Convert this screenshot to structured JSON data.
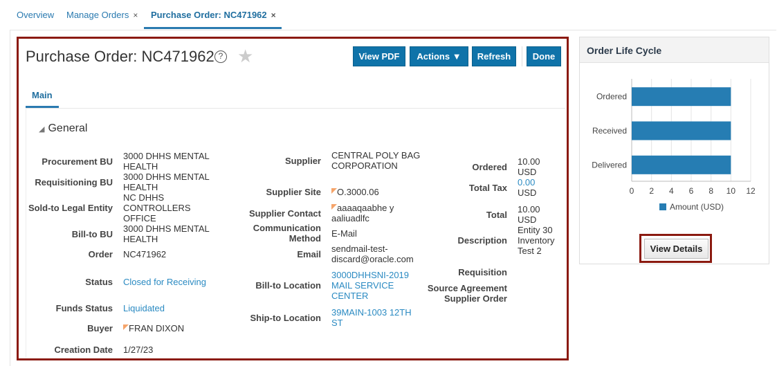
{
  "tabs": [
    {
      "label": "Overview"
    },
    {
      "label": "Manage Orders",
      "closable": true
    },
    {
      "label": "Purchase Order: NC471962",
      "closable": true,
      "active": true
    }
  ],
  "close_glyph": "×",
  "header": {
    "title": "Purchase Order: NC471962",
    "help": "?",
    "star": "★",
    "buttons": {
      "view_pdf": "View PDF",
      "actions": "Actions ▼",
      "refresh": "Refresh",
      "done": "Done"
    }
  },
  "main_tab": "Main",
  "section": {
    "title": "General",
    "toggle": "◢"
  },
  "col1": [
    {
      "label": "Procurement BU",
      "value": "3000 DHHS MENTAL HEALTH"
    },
    {
      "label": "Requisitioning BU",
      "value": "3000 DHHS MENTAL HEALTH"
    },
    {
      "label": "Sold-to Legal Entity",
      "value": "NC DHHS CONTROLLERS OFFICE"
    },
    {
      "label": "Bill-to BU",
      "value": "3000 DHHS MENTAL HEALTH"
    },
    {
      "label": "Order",
      "value": "NC471962"
    },
    {
      "label": "Status",
      "value": "Closed for Receiving"
    },
    {
      "label": "Funds Status",
      "value": "Liquidated"
    },
    {
      "label": "Buyer",
      "value": "FRAN DIXON"
    },
    {
      "label": "Creation Date",
      "value": "1/27/23"
    }
  ],
  "col2": [
    {
      "label": "Supplier",
      "value": "CENTRAL POLY BAG CORPORATION"
    },
    {
      "label": "Supplier Site",
      "value": "O.3000.06"
    },
    {
      "label": "Supplier Contact",
      "value": "aaaaqaabhe y aaliuadlfc"
    },
    {
      "label": "Communication Method",
      "value": "E-Mail"
    },
    {
      "label": "Email",
      "value": "sendmail-test-discard@oracle.com"
    },
    {
      "label": "Bill-to Location",
      "value": "3000DHHSNI-2019 MAIL SERVICE CENTER"
    },
    {
      "label": "Ship-to Location",
      "value": "39MAIN-1003 12TH ST"
    }
  ],
  "col3": [
    {
      "label": "Ordered",
      "value": "10.00 USD"
    },
    {
      "label": "Total Tax",
      "value": "0.00",
      "unit": "USD"
    },
    {
      "label": "Total",
      "value": "10.00 USD"
    },
    {
      "label": "Description",
      "value": "Entity 30 Inventory Test 2"
    },
    {
      "label": "Requisition",
      "value": ""
    },
    {
      "label": "Source Agreement Supplier Order",
      "value": ""
    }
  ],
  "panel": {
    "title": "Order Life Cycle",
    "view_details": "View Details"
  },
  "chart_data": {
    "type": "bar",
    "orientation": "horizontal",
    "categories": [
      "Ordered",
      "Received",
      "Delivered"
    ],
    "series": [
      {
        "name": "Amount (USD)",
        "values": [
          10,
          10,
          10
        ],
        "color": "#267db3"
      }
    ],
    "xlim": [
      0,
      12
    ],
    "xticks": [
      "0",
      "2",
      "4",
      "6",
      "8",
      "10",
      "12"
    ],
    "grid": true,
    "legend": "bottom"
  }
}
